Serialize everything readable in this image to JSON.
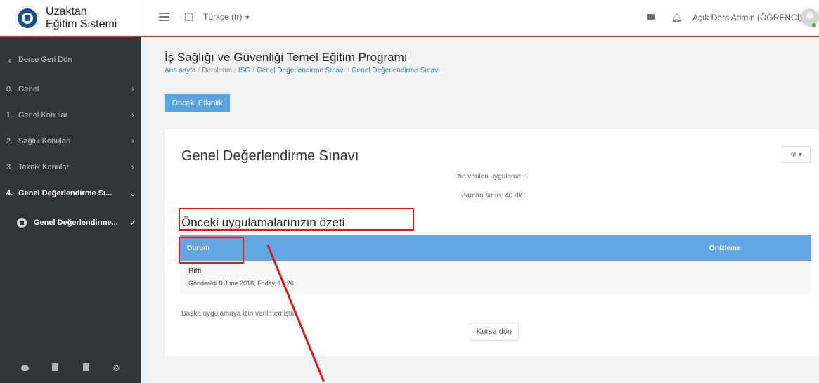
{
  "brand": {
    "line1": "Uzaktan",
    "line2": "Eğitim Sistemi"
  },
  "topbar": {
    "language": "Türkçe (tr)",
    "user": "Açık Ders Admin (ÖĞRENCİ)"
  },
  "sidebar": {
    "back": "Derse Geri Dön",
    "items": [
      {
        "num": "0.",
        "label": "Genel"
      },
      {
        "num": "1.",
        "label": "Genel Konular"
      },
      {
        "num": "2.",
        "label": "Sağlık Konuları"
      },
      {
        "num": "3.",
        "label": "Teknik Konular"
      },
      {
        "num": "4.",
        "label": "Genel Değerlendirme Sı..."
      }
    ],
    "activity": "Genel Değerlendirme..."
  },
  "header": {
    "title": "İş Sağlığı ve Güvenliği Temel Eğitim Programı",
    "breadcrumb": [
      "Ana sayfa",
      "Derslerim",
      "ISG",
      "Genel Değerlendirme Sınavı",
      "Genel Değerlendirme Sınavı"
    ],
    "prev_button": "Önceki Etkinlik"
  },
  "quiz": {
    "title": "Genel Değerlendirme Sınavı",
    "attempts_allowed": "İzin verilen uygulama: 1",
    "time_limit": "Zaman sınırı: 40 dk",
    "summary_title": "Önceki uygulamalarınızın özeti",
    "columns": [
      "Durum",
      "Önizleme"
    ],
    "attempt_state": "Bitti",
    "attempt_submitted": "Gönderildi 8 June 2018, Friday, 15:26",
    "no_more": "Başka uygulamaya izin verilmemiştir",
    "back_button": "Kursa dön"
  }
}
